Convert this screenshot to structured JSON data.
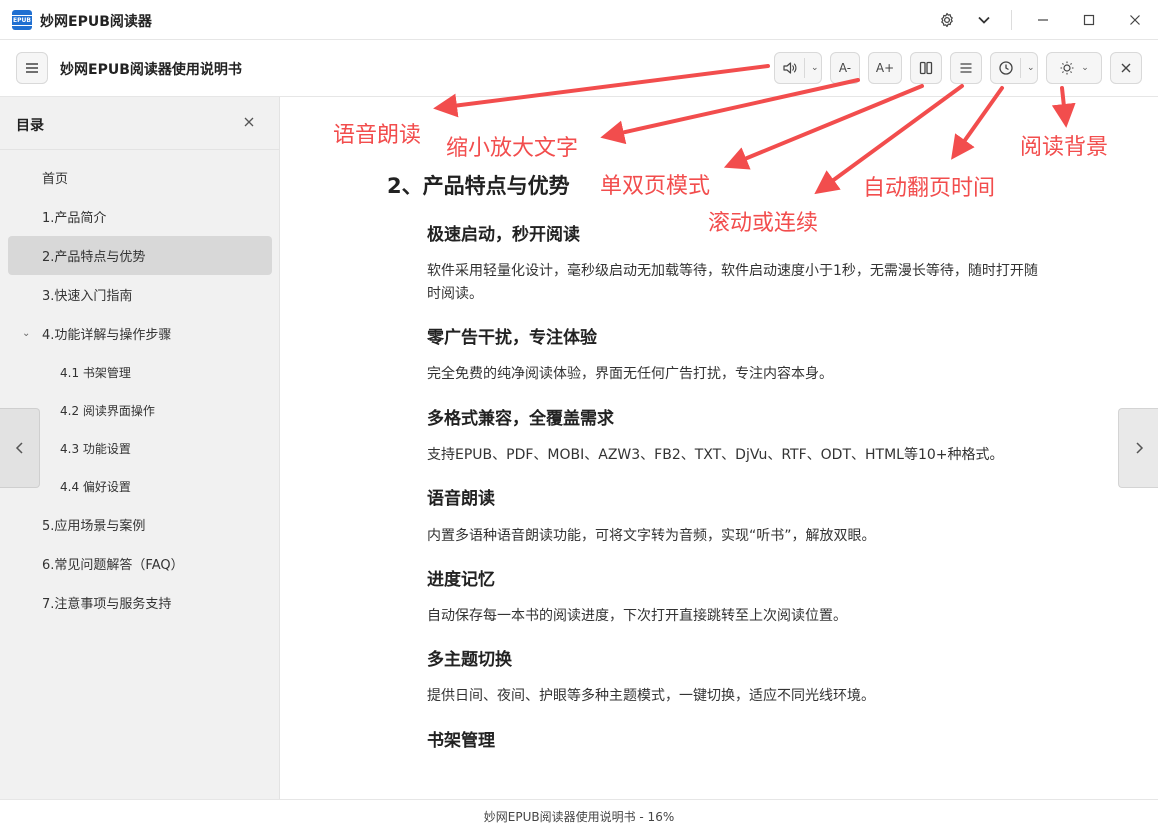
{
  "window": {
    "app_title": "妙网EPUB阅读器",
    "app_icon_text": "EPUB"
  },
  "toolbar": {
    "doc_title": "妙网EPUB阅读器使用说明书",
    "font_smaller": "A-",
    "font_larger": "A+"
  },
  "sidebar": {
    "title": "目录",
    "items": [
      {
        "label": "首页"
      },
      {
        "label": "1.产品简介"
      },
      {
        "label": "2.产品特点与优势",
        "active": true
      },
      {
        "label": "3.快速入门指南"
      },
      {
        "label": "4.功能详解与操作步骤",
        "expanded": true
      },
      {
        "label": "4.1 书架管理",
        "sub": true
      },
      {
        "label": "4.2 阅读界面操作",
        "sub": true
      },
      {
        "label": "4.3 功能设置",
        "sub": true
      },
      {
        "label": "4.4 偏好设置",
        "sub": true
      },
      {
        "label": "5.应用场景与案例"
      },
      {
        "label": "6.常见问题解答（FAQ）"
      },
      {
        "label": "7.注意事项与服务支持"
      }
    ]
  },
  "content": {
    "heading": "2、产品特点与优势",
    "sections": [
      {
        "title": "极速启动，秒开阅读",
        "text": "软件采用轻量化设计，毫秒级启动无加载等待，软件启动速度小于1秒，无需漫长等待，随时打开随时阅读。"
      },
      {
        "title": "零广告干扰，专注体验",
        "text": "完全免费的纯净阅读体验，界面无任何广告打扰，专注内容本身。"
      },
      {
        "title": "多格式兼容，全覆盖需求",
        "text": "支持EPUB、PDF、MOBI、AZW3、FB2、TXT、DjVu、RTF、ODT、HTML等10+种格式。"
      },
      {
        "title": "语音朗读",
        "text": "内置多语种语音朗读功能，可将文字转为音频，实现“听书”，解放双眼。"
      },
      {
        "title": "进度记忆",
        "text": "自动保存每一本书的阅读进度，下次打开直接跳转至上次阅读位置。"
      },
      {
        "title": "多主题切换",
        "text": "提供日间、夜间、护眼等多种主题模式，一键切换，适应不同光线环境。"
      },
      {
        "title": "书架管理",
        "text": ""
      }
    ]
  },
  "annotations": {
    "tts": "语音朗读",
    "font_size": "缩小放大文字",
    "page_mode": "单双页模式",
    "scroll": "滚动或连续",
    "auto_page": "自动翻页时间",
    "background": "阅读背景"
  },
  "status": {
    "text": "妙网EPUB阅读器使用说明书 - 16%"
  },
  "colors": {
    "accent": "#1f6fd1",
    "annotation": "#f24d4d",
    "sidebar_bg": "#f1f1f1",
    "active_item": "#d8d8d8"
  }
}
